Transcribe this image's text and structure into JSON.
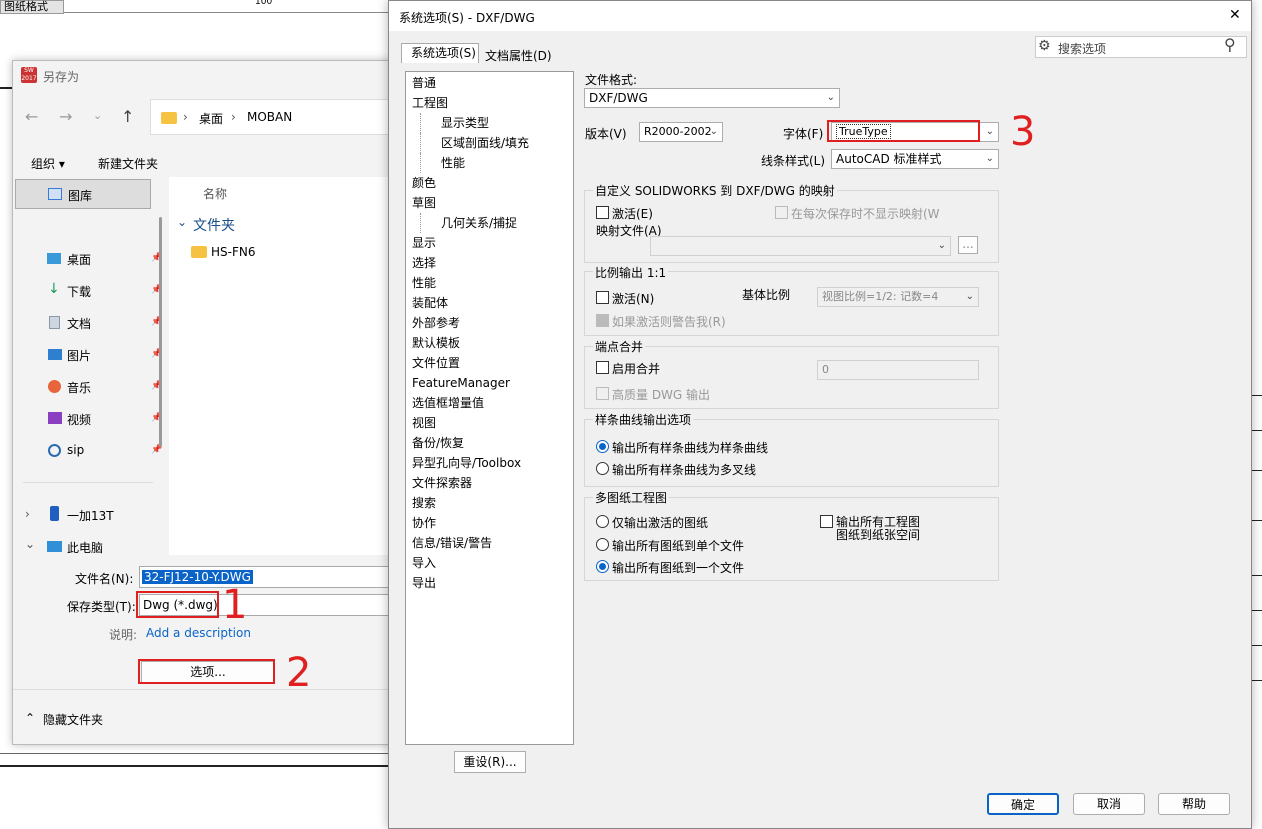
{
  "background": {
    "top_tab": "图纸格式",
    "ruler_mark": "100"
  },
  "save_dialog": {
    "title": "另存为",
    "app_badge": "SW 2017",
    "breadcrumb": [
      "桌面",
      "MOBAN"
    ],
    "toolbar": {
      "organize": "组织",
      "new_folder": "新建文件夹"
    },
    "nav": {
      "gallery": "图库",
      "quick": [
        "桌面",
        "下载",
        "文档",
        "图片",
        "音乐",
        "视频",
        "sip"
      ],
      "devices": [
        "一加13T",
        "此电脑"
      ]
    },
    "list": {
      "col_name": "名称",
      "group": "文件夹",
      "items": [
        "HS-FN6"
      ]
    },
    "filename_label": "文件名(N):",
    "filename_value": "32-FJ12-10-Y.DWG",
    "type_label": "保存类型(T):",
    "type_value": "Dwg (*.dwg)",
    "desc_label": "说明:",
    "desc_link": "Add a description",
    "options_button": "选项...",
    "hide_folders": "隐藏文件夹"
  },
  "options_dialog": {
    "title": "系统选项(S) - DXF/DWG",
    "close": "✕",
    "tabs": [
      "系统选项(S)",
      "文档属性(D)"
    ],
    "search_placeholder": "搜索选项",
    "tree": [
      {
        "label": "普通",
        "indent": 0
      },
      {
        "label": "工程图",
        "indent": 0
      },
      {
        "label": "显示类型",
        "indent": 1
      },
      {
        "label": "区域剖面线/填充",
        "indent": 1
      },
      {
        "label": "性能",
        "indent": 1
      },
      {
        "label": "颜色",
        "indent": 0
      },
      {
        "label": "草图",
        "indent": 0
      },
      {
        "label": "几何关系/捕捉",
        "indent": 1
      },
      {
        "label": "显示",
        "indent": 0
      },
      {
        "label": "选择",
        "indent": 0
      },
      {
        "label": "性能",
        "indent": 0
      },
      {
        "label": "装配体",
        "indent": 0
      },
      {
        "label": "外部参考",
        "indent": 0
      },
      {
        "label": "默认模板",
        "indent": 0
      },
      {
        "label": "文件位置",
        "indent": 0
      },
      {
        "label": "FeatureManager",
        "indent": 0
      },
      {
        "label": "选值框增量值",
        "indent": 0
      },
      {
        "label": "视图",
        "indent": 0
      },
      {
        "label": "备份/恢复",
        "indent": 0
      },
      {
        "label": "异型孔向导/Toolbox",
        "indent": 0
      },
      {
        "label": "文件探索器",
        "indent": 0
      },
      {
        "label": "搜索",
        "indent": 0
      },
      {
        "label": "协作",
        "indent": 0
      },
      {
        "label": "信息/错误/警告",
        "indent": 0
      },
      {
        "label": "导入",
        "indent": 0
      },
      {
        "label": "导出",
        "indent": 0
      }
    ],
    "reset_button": "重设(R)...",
    "file_format_label": "文件格式:",
    "file_format_value": "DXF/DWG",
    "version_label": "版本(V)",
    "version_value": "R2000-2002",
    "font_label": "字体(F)",
    "font_value": "TrueType",
    "linestyle_label": "线条样式(L)",
    "linestyle_value": "AutoCAD 标准样式",
    "mapping": {
      "title": "自定义 SOLIDWORKS 到 DXF/DWG 的映射",
      "activate": "激活(E)",
      "no_show": "在每次保存时不显示映射(W",
      "map_file": "映射文件(A)",
      "browse": "..."
    },
    "scale": {
      "title": "比例输出 1:1",
      "activate": "激活(N)",
      "base_label": "基体比例",
      "base_value": "视图比例=1/2: 记数=4",
      "warn": "如果激活则警告我(R)"
    },
    "merge": {
      "title": "端点合并",
      "enable": "启用合并",
      "value": "0",
      "hq": "高质量 DWG 输出"
    },
    "spline": {
      "title": "样条曲线输出选项",
      "opt1": "输出所有样条曲线为样条曲线",
      "opt2": "输出所有样条曲线为多叉线"
    },
    "multisheet": {
      "title": "多图纸工程图",
      "opt1": "仅输出激活的图纸",
      "opt2": "输出所有图纸到单个文件",
      "opt3": "输出所有图纸到一个文件",
      "paper_line1": "输出所有工程图",
      "paper_line2": "图纸到纸张空间"
    },
    "ok": "确定",
    "cancel": "取消",
    "help": "帮助"
  },
  "annotations": [
    "1",
    "2",
    "3"
  ]
}
